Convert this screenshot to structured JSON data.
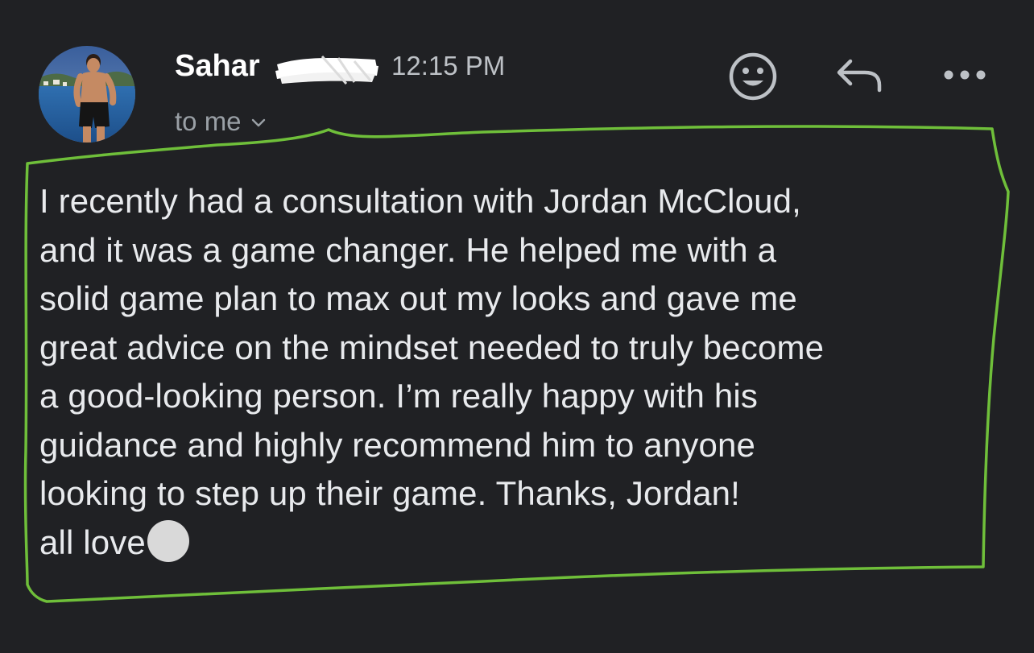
{
  "sender": {
    "name": "Sahar",
    "time": "12:15 PM",
    "recipient": "to me",
    "avatar_icon": "profile-photo"
  },
  "actions": {
    "react_icon": "smiley-face-icon",
    "reply_icon": "reply-arrow-icon",
    "more_icon": "more-horizontal-icon"
  },
  "message": {
    "lines": [
      "I recently had a consultation with Jordan McCloud,",
      "and it was a game changer. He helped me with a",
      "solid game plan to max out my looks and gave me",
      "great advice on the mindset needed to truly become",
      "a good-looking person. I’m really happy with his",
      "guidance and highly recommend him to anyone",
      "looking to step up their game. Thanks, Jordan!"
    ],
    "signoff": "all love"
  },
  "colors": {
    "background": "#202124",
    "text": "#e8eaed",
    "muted": "#9aa0a6",
    "annotation": "#6fbf3a"
  }
}
